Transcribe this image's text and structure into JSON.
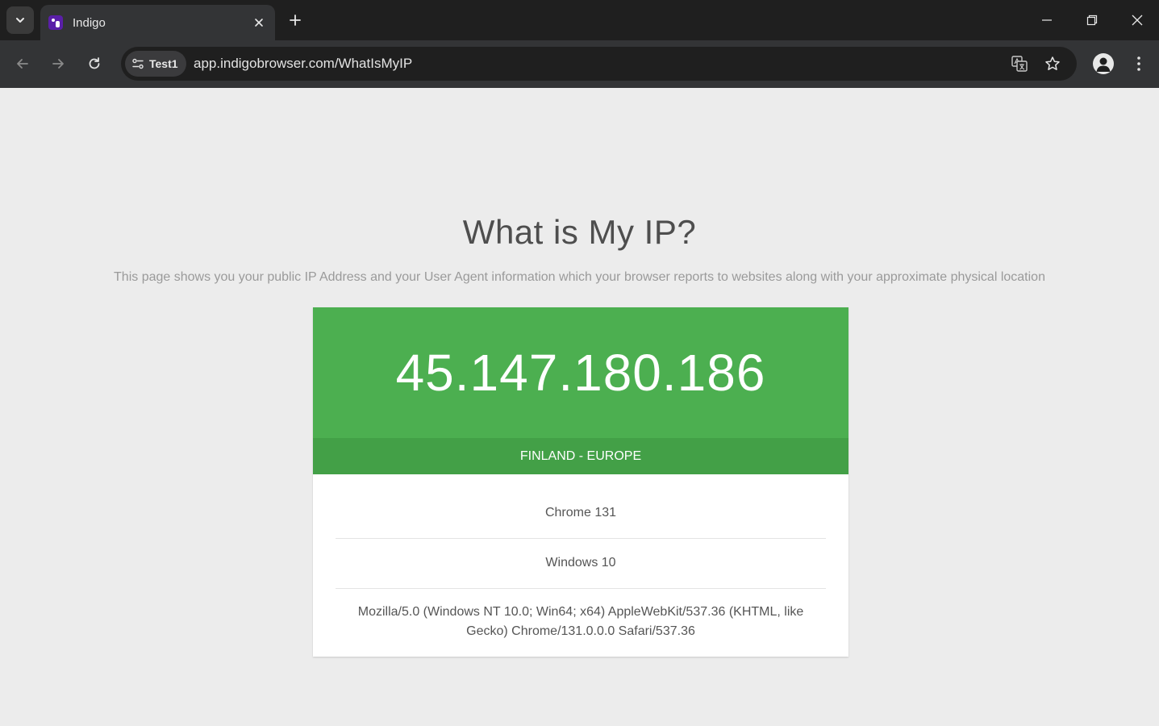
{
  "browser": {
    "tab": {
      "title": "Indigo"
    },
    "toolbar": {
      "profile_chip_label": "Test1",
      "url": "app.indigobrowser.com/WhatIsMyIP"
    }
  },
  "page": {
    "title": "What is My IP?",
    "description": "This page shows you your public IP Address and your User Agent information which your browser reports to websites along with your approximate physical location",
    "ip_address": "45.147.180.186",
    "location": "FINLAND - EUROPE",
    "browser_name": "Chrome 131",
    "os": "Windows 10",
    "user_agent": "Mozilla/5.0 (Windows NT 10.0; Win64; x64) AppleWebKit/537.36 (KHTML, like Gecko) Chrome/131.0.0.0 Safari/537.36"
  },
  "colors": {
    "ip_box": "#4caf50",
    "location_bar": "#43a047",
    "favicon": "#5a1fa8"
  }
}
